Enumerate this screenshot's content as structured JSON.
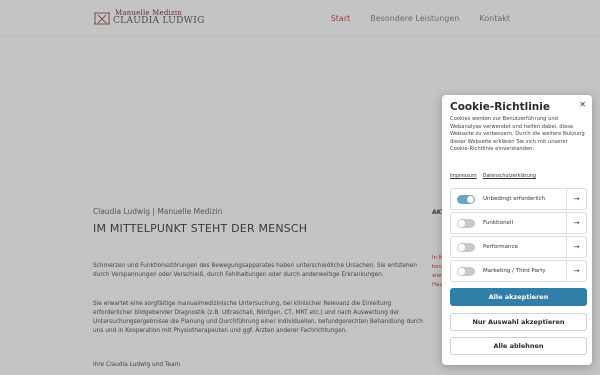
{
  "header": {
    "logo": {
      "top_line": "Manuelle Medizin",
      "bottom_line": "CLAUDIA LUDWIG",
      "mark_icon": "columns-logo-icon"
    },
    "nav": [
      {
        "label": "Start",
        "active": true
      },
      {
        "label": "Besondere Leistungen",
        "active": false
      },
      {
        "label": "Kontakt",
        "active": false
      }
    ]
  },
  "content": {
    "subtitle": "Claudia Ludwig | Manuelle Medizin",
    "headline": "IM MITTELPUNKT STEHT DER MENSCH",
    "paragraphs": [
      "Schmerzen und Funktionsstörungen des Bewegungsapparates haben unterschiedliche Ursachen. Sie entstehen durch Verspannungen oder Verschleiß, durch Fehlhaltungen oder durch anderweitige Erkrankungen.",
      "Sie erwartet eine sorgfältige manualmedizinische Untersuchung, bei klinischer Relevanz die Einleitung erforderlicher bildgebender Diagnostik (z.B. Ultraschall, Röntgen, CT, MRT etc.) und nach Auswertung der Untersuchungsergebnisse die Planung und Durchführung einer individuellen, befundgerechten Behandlung  durch uns und in Kooperation mit Physiotherapeuten und ggf. Ärzten anderer Fachrichtungen.",
      "Ihre Claudia Ludwig und Team"
    ],
    "side_title": "AKT",
    "side_text": [
      "In M",
      "kon",
      "wie",
      "Hau"
    ]
  },
  "cookie": {
    "title": "Cookie-Richtlinie",
    "close_icon": "close-icon",
    "text": "Cookies werden zur Benutzerführung und Webanalyse verwendet und helfen dabei, diese Webseite zu verbessern. Durch die weitere Nutzung dieser Webseite erklären Sie sich mit unserer Cookie-Richtlinie einverstanden.",
    "links": {
      "impressum": "Impressum",
      "datenschutz": "Datenschutzerklärung"
    },
    "categories": [
      {
        "label": "Unbedingt erforderlich",
        "enabled": true
      },
      {
        "label": "Funktionell",
        "enabled": false
      },
      {
        "label": "Performance",
        "enabled": false
      },
      {
        "label": "Marketing / Third Party",
        "enabled": false
      }
    ],
    "arrow_icon": "arrow-right-icon",
    "buttons": {
      "accept_all": "Alle akzeptieren",
      "accept_selection": "Nur Auswahl akzeptieren",
      "reject_all": "Alle ablehnen"
    },
    "colors": {
      "primary": "#2f7fa8",
      "toggle_on": "#6aa3c4"
    }
  }
}
